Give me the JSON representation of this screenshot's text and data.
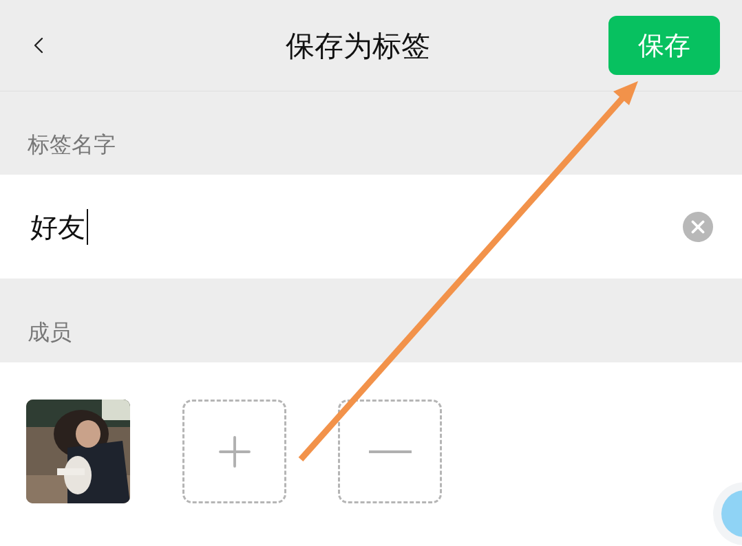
{
  "header": {
    "title": "保存为标签",
    "save_button": "保存"
  },
  "name_section": {
    "label": "标签名字",
    "value": "好友"
  },
  "members_section": {
    "label": "成员"
  }
}
